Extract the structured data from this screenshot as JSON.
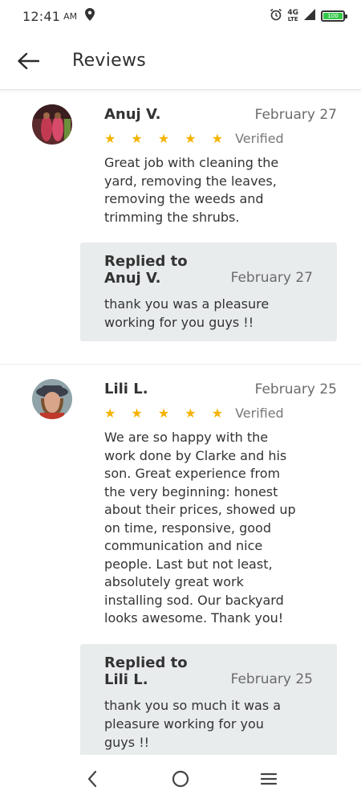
{
  "status_bar": {
    "time": "12:41",
    "ampm": "AM",
    "network": "4G",
    "network_sub": "LTE",
    "battery_label": "100",
    "battery_color": "#35c84a"
  },
  "app_bar": {
    "title": "Reviews"
  },
  "colors": {
    "star": "#f5b301",
    "reply_bg": "#e9eced"
  },
  "reviews": [
    {
      "name": "Anuj V.",
      "date": "February 27",
      "stars": "★ ★ ★ ★ ★",
      "rating": 5,
      "verified": "Verified",
      "text": "Great job with cleaning the yard, removing the leaves, removing the weeds and trimming the shrubs.",
      "reply": {
        "title_line1": "Replied to",
        "title_line2": "Anuj V.",
        "date": "February 27",
        "text": "thank you was a pleasure working for you guys !!"
      }
    },
    {
      "name": "Lili L.",
      "date": "February 25",
      "stars": "★ ★ ★ ★ ★",
      "rating": 5,
      "verified": "Verified",
      "text": "We are so happy with the work done by Clarke and his son. Great experience from the very beginning: honest about their prices, showed up on time, responsive, good communication and nice people. Last but not least, absolutely great work installing sod. Our backyard looks awesome. Thank you!",
      "reply": {
        "title_line1": "Replied to",
        "title_line2": "Lili L.",
        "date": "February 25",
        "text": "thank you so much it was a pleasure working for you guys !!"
      }
    }
  ],
  "nav_bar": {
    "back_icon": "chevron-left-icon",
    "home_icon": "circle-home-icon",
    "menu_icon": "hamburger-menu-icon"
  }
}
